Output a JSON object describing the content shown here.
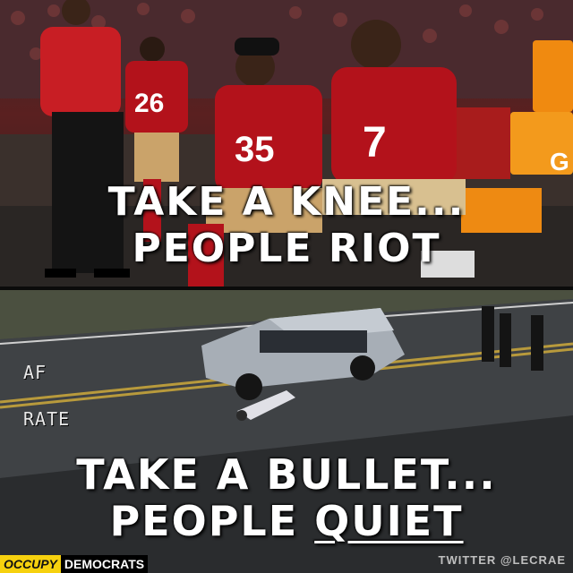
{
  "top_caption": {
    "line1": "TAKE A KNEE...",
    "line2": "PEOPLE RIOT"
  },
  "bottom_caption": {
    "line1": "TAKE A BULLET...",
    "line2_prefix": "PEOPLE ",
    "line2_underlined": "QUIET"
  },
  "hud": {
    "af": "AF",
    "rate": "RATE"
  },
  "jerseys": {
    "left": "26",
    "center": "35",
    "right": "7"
  },
  "signage": {
    "cooler_letter": "G"
  },
  "branding": {
    "occupy": "OCCUPY",
    "democrats": "DEMOCRATS",
    "credit": "TWITTER @LECRAE"
  },
  "colors": {
    "team_red": "#b3121b",
    "cooler_orange": "#f08a10",
    "brand_yellow": "#f6d10e",
    "road_gray": "#3b3d40"
  }
}
